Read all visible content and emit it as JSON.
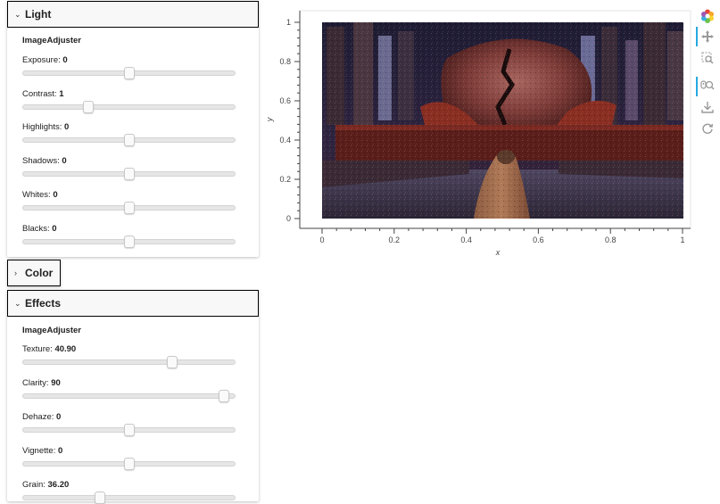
{
  "light_card": {
    "title": "Light",
    "group_title": "ImageAdjuster",
    "sliders": [
      {
        "name": "Exposure",
        "value_text": "0",
        "fraction": 0.5
      },
      {
        "name": "Contrast",
        "value_text": "1",
        "fraction": 0.31
      },
      {
        "name": "Highlights",
        "value_text": "0",
        "fraction": 0.5
      },
      {
        "name": "Shadows",
        "value_text": "0",
        "fraction": 0.5
      },
      {
        "name": "Whites",
        "value_text": "0",
        "fraction": 0.5
      },
      {
        "name": "Blacks",
        "value_text": "0",
        "fraction": 0.5
      }
    ]
  },
  "color_card": {
    "title": "Color"
  },
  "effects_card": {
    "title": "Effects",
    "group_title": "ImageAdjuster",
    "sliders": [
      {
        "name": "Texture",
        "value_text": "40.90",
        "fraction": 0.705
      },
      {
        "name": "Clarity",
        "value_text": "90",
        "fraction": 0.95
      },
      {
        "name": "Dehaze",
        "value_text": "0",
        "fraction": 0.5
      },
      {
        "name": "Vignette",
        "value_text": "0",
        "fraction": 0.5
      },
      {
        "name": "Grain",
        "value_text": "36.20",
        "fraction": 0.362
      }
    ]
  },
  "plot": {
    "xlabel": "x",
    "ylabel": "y",
    "x_ticks": [
      "0",
      "0.2",
      "0.4",
      "0.6",
      "0.8",
      "1"
    ],
    "y_ticks": [
      "0",
      "0.2",
      "0.4",
      "0.6",
      "0.8",
      "1"
    ],
    "xlim": [
      0,
      1
    ],
    "ylim": [
      0,
      1
    ]
  },
  "toolbar": {
    "tools": [
      "bokeh-logo-icon",
      "pan-icon",
      "box-zoom-icon",
      "wheel-zoom-icon",
      "save-icon",
      "reset-icon"
    ]
  }
}
